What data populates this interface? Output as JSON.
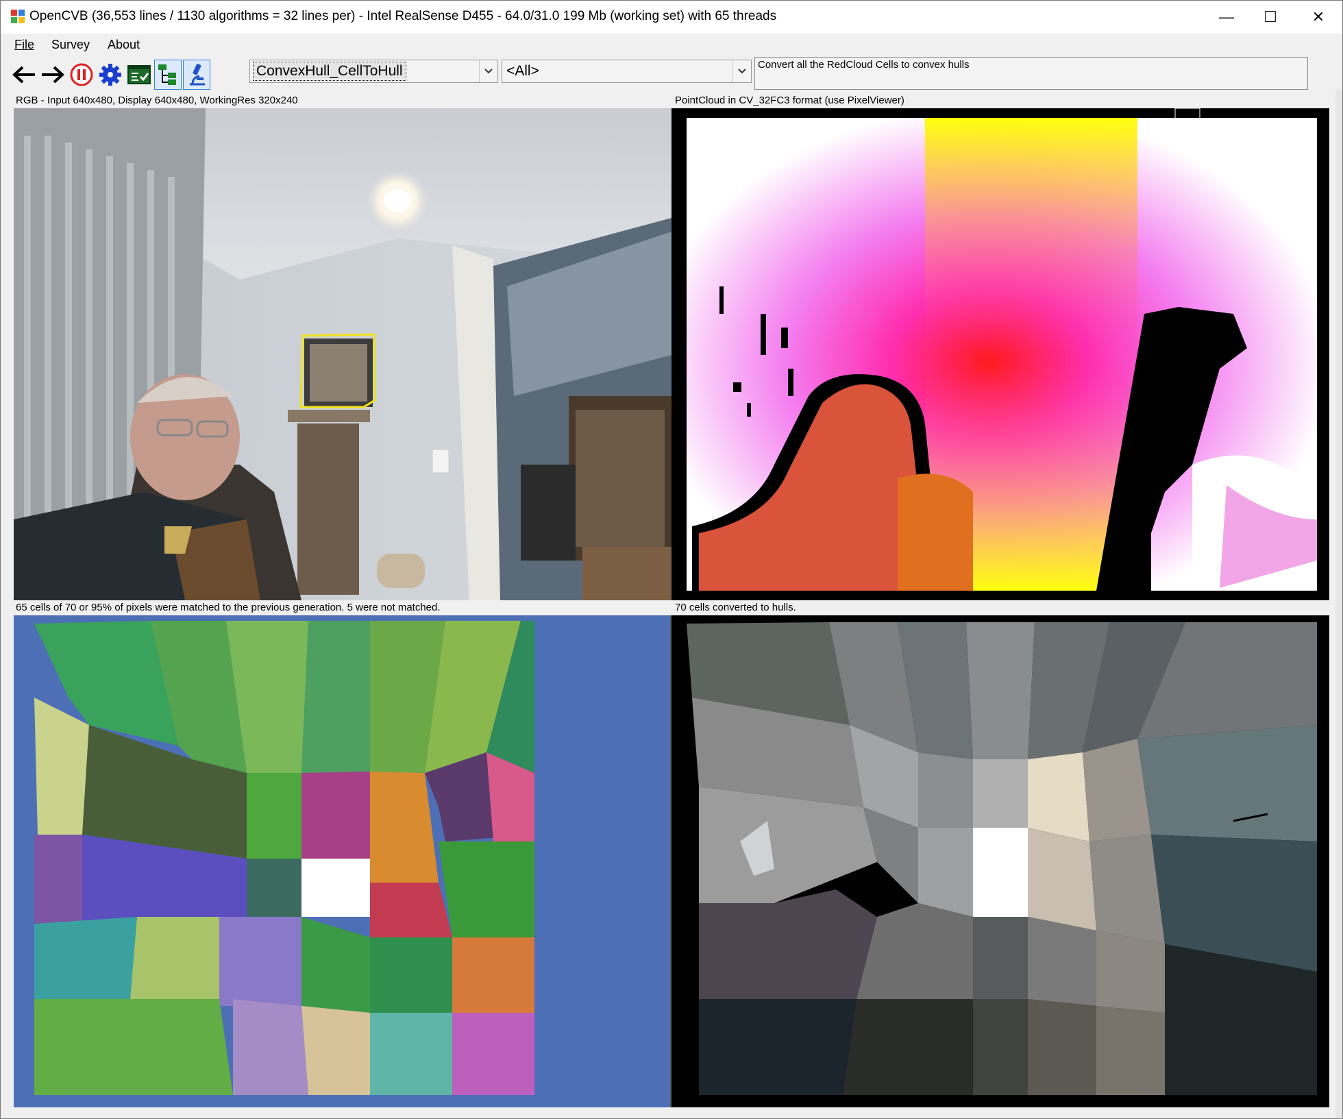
{
  "window": {
    "title": "OpenCVB (36,553 lines / 1130 algorithms = 32 lines per) - Intel RealSense D455 - 64.0/31.0 199 Mb (working set) with 65 threads",
    "controls": {
      "minimize": "—",
      "maximize": "☐",
      "close": "✕"
    }
  },
  "menu": {
    "items": [
      "File",
      "Survey",
      "About"
    ]
  },
  "toolbar": {
    "icons": [
      "back-arrow-icon",
      "forward-arrow-icon",
      "pause-icon",
      "gear-icon",
      "test-all-icon",
      "tree-view-icon",
      "microscope-icon"
    ],
    "algorithm_combo": "ConvexHull_CellToHull",
    "group_combo": "<All>",
    "description": "Convert all the RedCloud Cells to convex hulls"
  },
  "panes": {
    "top_left_label": "RGB - Input 640x480, Display 640x480, WorkingRes 320x240",
    "top_right_label": "PointCloud in CV_32FC3 format (use PixelViewer)",
    "bottom_left_label": "65 cells of 70 or 95% of pixels were matched to the previous generation. 5 were not matched.",
    "bottom_right_label": "70 cells converted to hulls."
  },
  "colors": {
    "highlight_box": "#f2e21a",
    "accent": "#2d7fd8",
    "pause_red": "#e02020",
    "gear_blue": "#1a3fcf"
  }
}
